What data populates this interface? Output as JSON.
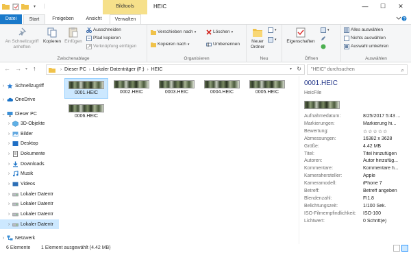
{
  "window": {
    "title": "HEIC",
    "context_tab": "Bildtools",
    "minimize": "—",
    "maximize": "☐",
    "close": "✕"
  },
  "tabs": {
    "datei": "Datei",
    "start": "Start",
    "freigeben": "Freigeben",
    "ansicht": "Ansicht",
    "verwalten": "Verwalten"
  },
  "ribbon": {
    "zwischenablage": {
      "label": "Zwischenablage",
      "pin": "An Schnellzugriff anheften",
      "kopieren": "Kopieren",
      "einfuegen": "Einfügen",
      "ausschneiden": "Ausschneiden",
      "pfad_kopieren": "Pfad kopieren",
      "verknuepfung": "Verknüpfung einfügen"
    },
    "organisieren": {
      "label": "Organisieren",
      "verschieben": "Verschieben nach",
      "kopieren_nach": "Kopieren nach",
      "loeschen": "Löschen",
      "umbenennen": "Umbenennen"
    },
    "neu": {
      "label": "Neu",
      "neuer_ordner": "Neuer Ordner"
    },
    "oeffnen": {
      "label": "Öffnen",
      "eigenschaften": "Eigenschaften"
    },
    "auswaehlen": {
      "label": "Auswählen",
      "alles": "Alles auswählen",
      "nichts": "Nichts auswählen",
      "umkehren": "Auswahl umkehren"
    }
  },
  "address": {
    "crumbs": [
      "Dieser PC",
      "Lokaler Datenträger (F:)",
      "HEIC"
    ],
    "search_placeholder": "\"HEIC\" durchsuchen"
  },
  "nav": [
    {
      "label": "Schnellzugriff",
      "icon": "star-icon",
      "expandable": true
    },
    {
      "label": "OneDrive",
      "icon": "cloud-icon",
      "expandable": true
    },
    {
      "label": "Dieser PC",
      "icon": "computer-icon",
      "expandable": false
    },
    {
      "label": "3D-Objekte",
      "icon": "cube-icon",
      "expandable": true
    },
    {
      "label": "Bilder",
      "icon": "pictures-icon",
      "expandable": true
    },
    {
      "label": "Desktop",
      "icon": "desktop-icon",
      "expandable": true
    },
    {
      "label": "Dokumente",
      "icon": "documents-icon",
      "expandable": true
    },
    {
      "label": "Downloads",
      "icon": "download-icon",
      "expandable": true
    },
    {
      "label": "Musik",
      "icon": "music-icon",
      "expandable": true
    },
    {
      "label": "Videos",
      "icon": "video-icon",
      "expandable": true
    },
    {
      "label": "Lokaler Datentr",
      "icon": "drive-icon",
      "expandable": true
    },
    {
      "label": "Lokaler Datentr",
      "icon": "drive-icon",
      "expandable": true
    },
    {
      "label": "Lokaler Datentr",
      "icon": "drive-icon",
      "expandable": true
    },
    {
      "label": "Lokaler Datentr",
      "icon": "drive-icon",
      "expandable": true
    },
    {
      "label": "Netzwerk",
      "icon": "network-icon",
      "expandable": true
    }
  ],
  "files": [
    "0001.HEIC",
    "0002.HEIC",
    "0003.HEIC",
    "0004.HEIC",
    "0005.HEIC",
    "0006.HEIC"
  ],
  "details": {
    "title": "0001.HEIC",
    "type": "HeicFile",
    "rating": "☆☆☆☆☆",
    "properties": [
      {
        "k": "Aufnahmedatum:",
        "v": "8/25/2017 5:43 ..."
      },
      {
        "k": "Markierungen:",
        "v": "Markierung hi..."
      },
      {
        "k": "Bewertung:",
        "v": ""
      },
      {
        "k": "Abmessungen:",
        "v": "16382 x 3628"
      },
      {
        "k": "Größe:",
        "v": "4.42 MB"
      },
      {
        "k": "Titel:",
        "v": "Titel hinzufügen"
      },
      {
        "k": "Autoren:",
        "v": "Autor hinzufüg..."
      },
      {
        "k": "Kommentare:",
        "v": "Kommentare h..."
      },
      {
        "k": "Kamerahersteller:",
        "v": "Apple"
      },
      {
        "k": "Kameramodell:",
        "v": "iPhone 7"
      },
      {
        "k": "Betreff:",
        "v": "Betreff angeben"
      },
      {
        "k": "Blendenzahl:",
        "v": "F/1.8"
      },
      {
        "k": "Belichtungszeit:",
        "v": "1/100 Sek."
      },
      {
        "k": "ISO-Filmempfindlichkeit:",
        "v": "ISO-100"
      },
      {
        "k": "Lichtwert:",
        "v": "0 Schritt(e)"
      }
    ]
  },
  "status": {
    "count": "6 Elemente",
    "selection": "1 Element ausgewählt (4.42 MB)"
  }
}
